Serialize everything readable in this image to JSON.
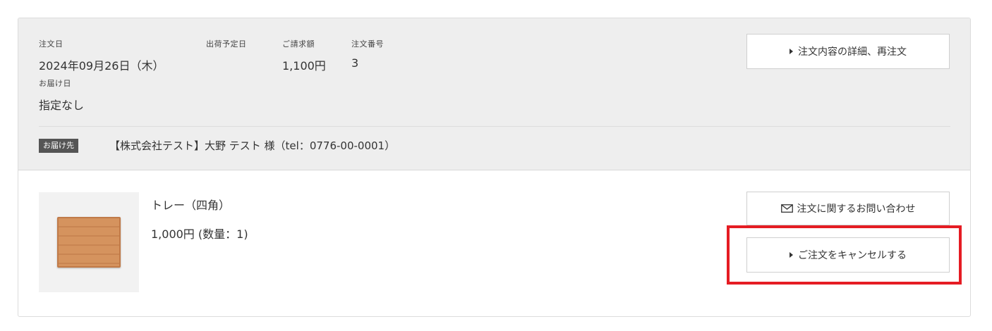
{
  "order": {
    "order_date_label": "注文日",
    "order_date": "2024年09月26日（木）",
    "ship_date_label": "出荷予定日",
    "ship_date": "",
    "amount_label": "ご請求額",
    "amount": "1,100円",
    "order_number_label": "注文番号",
    "order_number": "3",
    "delivery_date_label": "お届け日",
    "delivery_date": "指定なし",
    "details_button": "注文内容の詳細、再注文"
  },
  "destination": {
    "badge": "お届け先",
    "address": "【株式会社テスト】大野 テスト 様（tel：0776-00-0001）"
  },
  "item": {
    "name": "トレー（四角）",
    "price": "1,000円 (数量：1)",
    "image_icon": "wooden-tray-thumbnail"
  },
  "actions": {
    "inquiry_button": "注文に関するお問い合わせ",
    "inquiry_icon": "mail-icon",
    "cancel_button": "ご注文をキャンセルする"
  },
  "colors": {
    "header_bg": "#eeeeee",
    "badge_bg": "#555555",
    "highlight_border": "#e51c23"
  }
}
